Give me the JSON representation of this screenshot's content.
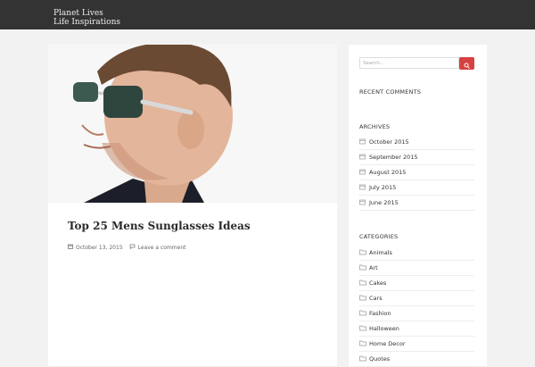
{
  "site": {
    "title_line1": "Planet Lives",
    "title_line2": "Life Inspirations"
  },
  "post": {
    "title": "Top 25 Mens Sunglasses Ideas",
    "date": "October 13, 2015",
    "comment_link": "Leave a comment"
  },
  "sidebar": {
    "search_placeholder": "Search...",
    "recent_comments_title": "RECENT COMMENTS",
    "archives_title": "ARCHIVES",
    "archives": [
      "October 2015",
      "September 2015",
      "August 2015",
      "July 2015",
      "June 2015"
    ],
    "categories_title": "CATEGORIES",
    "categories": [
      "Animals",
      "Art",
      "Cakes",
      "Cars",
      "Fashion",
      "Halloween",
      "Home Decor",
      "Quotes"
    ]
  },
  "colors": {
    "topbar": "#333333",
    "accent": "#d64242"
  }
}
